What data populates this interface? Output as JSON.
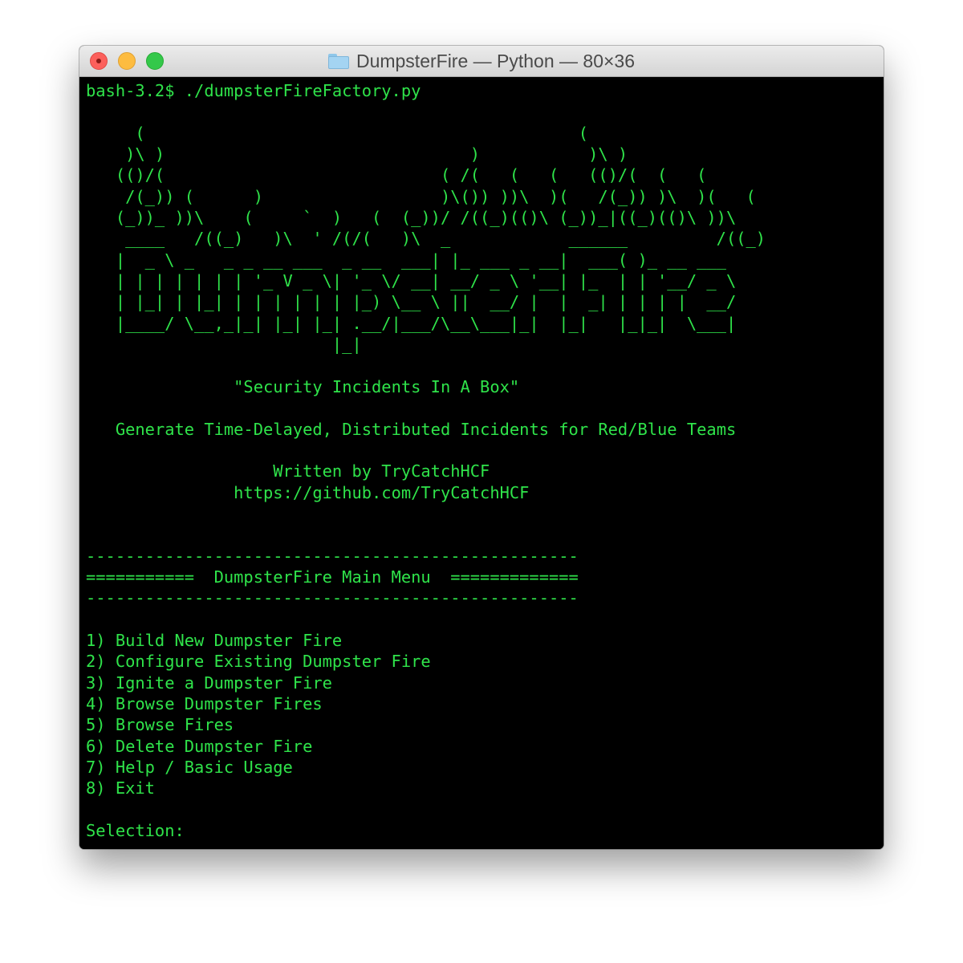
{
  "window": {
    "title": "DumpsterFire — Python — 80×36",
    "folder_icon": "folder-icon",
    "controls": [
      "close-button",
      "minimize-button",
      "zoom-button"
    ]
  },
  "colors": {
    "terminal_background": "#000000",
    "terminal_text": "#2fe34a",
    "cursor": "#9a9a9a"
  },
  "terminal": {
    "command_line": "bash-3.2$ ./dumpsterFireFactory.py",
    "banner_art": [
      "     (                                            (",
      "    )\\ )                               )           )\\ )",
      "   (()/(                            ( /(   (   (   (()/(  (   (",
      "    /(_)) (      )                  )\\()) ))\\  )(   /(_)) )\\  )(   (",
      "   (_))_ ))\\    (     `  )   (  (_))/ /((_)(()\\ (_))_|((_)(()\\ ))\\",
      "    ____   /((_)   )\\  ' /(/(   )\\  _            ______         /((_)",
      "   |  _ \\ _   _ _ __ ___  _ __  ___| |_ ___ _ __|  ___( )_ __ ___",
      "   | | | | | | | '_ V _ \\| '_ \\/ __| __/ _ \\ '__| |_  | | '__/ _ \\",
      "   | |_| | |_| | | | | | | |_) \\__ \\ ||  __/ |  |  _| | | | |  __/",
      "   |____/ \\__,_|_| |_| |_| .__/|___/\\__\\___|_|  |_|   |_|_|  \\___|",
      "                         |_|"
    ],
    "tagline": "\"Security Incidents In A Box\"",
    "description": "Generate Time-Delayed, Distributed Incidents for Red/Blue Teams",
    "author": "Written by TryCatchHCF",
    "url": "https://github.com/TryCatchHCF",
    "menu_rule": "--------------------------------------------------",
    "menu_title_line": "===========  DumpsterFire Main Menu  =============",
    "menu_items": [
      "1) Build New Dumpster Fire",
      "2) Configure Existing Dumpster Fire",
      "3) Ignite a Dumpster Fire",
      "4) Browse Dumpster Fires",
      "5) Browse Fires",
      "6) Delete Dumpster Fire",
      "7) Help / Basic Usage",
      "8) Exit"
    ],
    "prompt": "Selection: "
  }
}
